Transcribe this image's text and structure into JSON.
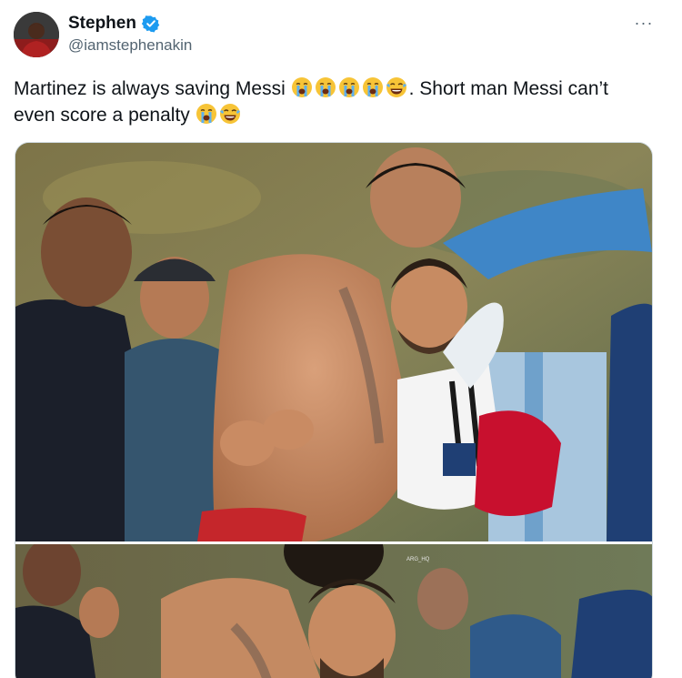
{
  "author": {
    "display_name": "Stephen",
    "handle": "@iamstephenakin",
    "verified": true,
    "avatar_icon": "avatar"
  },
  "menu": {
    "more_icon": "more-icon",
    "more_label": "···"
  },
  "tweet": {
    "text_line1": "Martinez is always saving Messi ",
    "text_line1_suffix": ". Short man Messi can’t",
    "text_line2": "even score a penalty ",
    "emoji_line1": [
      "loudly-crying-face",
      "loudly-crying-face",
      "loudly-crying-face",
      "loudly-crying-face",
      "face-with-tears-of-joy"
    ],
    "emoji_line2": [
      "loudly-crying-face",
      "face-with-tears-of-joy"
    ]
  },
  "media": {
    "photo_count": 2,
    "watermark": "ARG_HQ"
  },
  "colors": {
    "verified_blue": "#1d9bf0",
    "handle_gray": "#536471",
    "text": "#0f1419"
  }
}
